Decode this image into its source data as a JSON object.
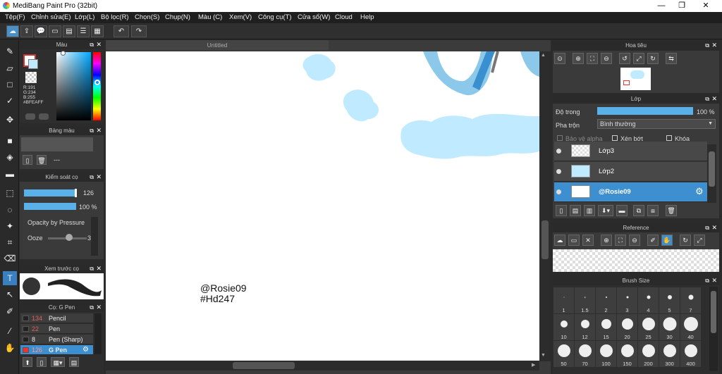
{
  "app": {
    "title": "MediBang Paint Pro (32bit)"
  },
  "menu": [
    "Tệp(F)",
    "Chỉnh sửa(E)",
    "Lớp(L)",
    "Bộ lọc(R)",
    "Chọn(S)",
    "Chụp(N)",
    "Màu (C)",
    "Xem(V)",
    "Công cụ(T)",
    "Cửa sổ(W)",
    "Cloud",
    "Help"
  ],
  "canvas": {
    "tab_title": "Untitled",
    "text_line1": "@Rosie09",
    "text_line2": "#Hd247"
  },
  "color_panel": {
    "title": "Màu",
    "r": "R:191",
    "g": "G:234",
    "b": "B:255",
    "hex": "#BFEAFF"
  },
  "palette_panel": {
    "title": "Bảng màu",
    "dash": "---"
  },
  "brush_control": {
    "title": "Kiểm soát cọ",
    "size_value": "126",
    "opacity_value": "100 %",
    "opacity_pressure_label": "Opacity by Pressure",
    "ooze_label": "Ooze",
    "ooze_value": "3"
  },
  "brush_preview": {
    "title": "Xem trước cọ"
  },
  "brush_list": {
    "title": "Cọ: G Pen",
    "items": [
      {
        "num": "134",
        "name": "Pencil"
      },
      {
        "num": "22",
        "name": "Pen"
      },
      {
        "num": "8",
        "name": "Pen (Sharp)"
      },
      {
        "num": "126",
        "name": "G Pen"
      }
    ]
  },
  "navigator": {
    "title": "Hoa tiêu"
  },
  "layers": {
    "title": "Lớp",
    "opacity_label": "Độ trong",
    "opacity_value": "100 %",
    "opacity": 1.0,
    "blend_label": "Pha trộn",
    "blend_value": "Bình thường",
    "protect_alpha": "Bảo vệ alpha",
    "clipping": "Xén bớt",
    "lock": "Khóa",
    "items": [
      {
        "name": "Lớp3"
      },
      {
        "name": "Lớp2"
      },
      {
        "name": "@Rosie09"
      }
    ]
  },
  "reference": {
    "title": "Reference"
  },
  "brush_size": {
    "title": "Brush Size",
    "sizes": [
      "1",
      "1.5",
      "2",
      "3",
      "4",
      "5",
      "7",
      "10",
      "12",
      "15",
      "20",
      "25",
      "30",
      "40",
      "50",
      "70",
      "100",
      "150",
      "200",
      "300",
      "400"
    ]
  },
  "colors": {
    "accent": "#3d8fd0",
    "canvas_blue": "#bfeaff"
  }
}
